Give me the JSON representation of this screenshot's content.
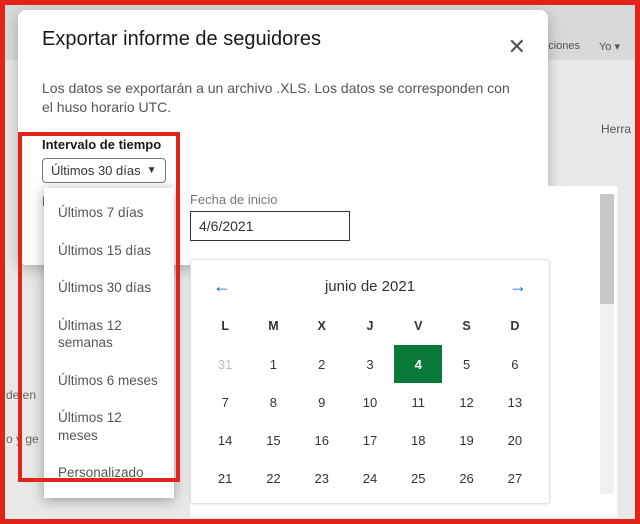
{
  "background": {
    "topRight1": "caciones",
    "topRight2": "Yo ▾",
    "sideLink": "Herra",
    "label1": "de en",
    "label2": "o y ge"
  },
  "modal": {
    "title": "Exportar informe de seguidores",
    "description": "Los datos se exportarán a un archivo .XLS. Los datos se corresponden con el huso horario UTC.",
    "intervalLabel": "Intervalo de tiempo",
    "intervalSelected": "Últimos 30 días",
    "truncD": "D"
  },
  "dropdown": {
    "items": [
      "Últimos 7 días",
      "Últimos 15 días",
      "Últimos 30 días",
      "Últimas 12 semanas",
      "Últimos 6 meses",
      "Últimos 12 meses",
      "Personalizado"
    ]
  },
  "datePanel": {
    "startLabel": "Fecha de inicio",
    "startValue": "4/6/2021"
  },
  "calendar": {
    "monthLabel": "junio de 2021",
    "dow": [
      "L",
      "M",
      "X",
      "J",
      "V",
      "S",
      "D"
    ],
    "rows": [
      [
        {
          "n": "31",
          "other": true
        },
        {
          "n": "1"
        },
        {
          "n": "2"
        },
        {
          "n": "3"
        },
        {
          "n": "4",
          "sel": true
        },
        {
          "n": "5"
        },
        {
          "n": "6"
        }
      ],
      [
        {
          "n": "7"
        },
        {
          "n": "8"
        },
        {
          "n": "9"
        },
        {
          "n": "10"
        },
        {
          "n": "11"
        },
        {
          "n": "12"
        },
        {
          "n": "13"
        }
      ],
      [
        {
          "n": "14"
        },
        {
          "n": "15"
        },
        {
          "n": "16"
        },
        {
          "n": "17"
        },
        {
          "n": "18"
        },
        {
          "n": "19"
        },
        {
          "n": "20"
        }
      ],
      [
        {
          "n": "21"
        },
        {
          "n": "22"
        },
        {
          "n": "23"
        },
        {
          "n": "24"
        },
        {
          "n": "25"
        },
        {
          "n": "26"
        },
        {
          "n": "27"
        }
      ]
    ]
  }
}
